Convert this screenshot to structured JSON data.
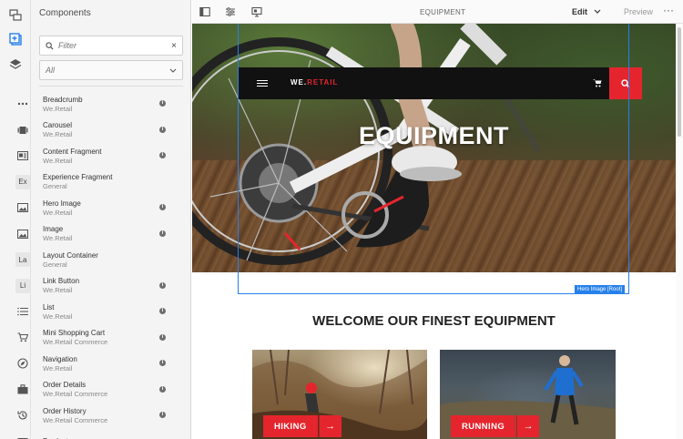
{
  "panel": {
    "title": "Components",
    "filter_placeholder": "Filter",
    "filter_clear": "×",
    "group_select": "All",
    "items": [
      {
        "name": "Breadcrumb",
        "group": "We.Retail",
        "icon": "more-horizontal-icon",
        "has_info": true
      },
      {
        "name": "Carousel",
        "group": "We.Retail",
        "icon": "carousel-icon",
        "has_info": true
      },
      {
        "name": "Content Fragment",
        "group": "We.Retail",
        "icon": "content-fragment-icon",
        "has_info": true
      },
      {
        "name": "Experience Fragment",
        "group": "General",
        "badge": "Ex",
        "has_info": false
      },
      {
        "name": "Hero Image",
        "group": "We.Retail",
        "icon": "image-icon",
        "has_info": true
      },
      {
        "name": "Image",
        "group": "We.Retail",
        "icon": "image-icon",
        "has_info": true
      },
      {
        "name": "Layout Container",
        "group": "General",
        "badge": "La",
        "has_info": false
      },
      {
        "name": "Link Button",
        "group": "We.Retail",
        "badge": "Li",
        "has_info": true
      },
      {
        "name": "List",
        "group": "We.Retail",
        "icon": "list-icon",
        "has_info": true
      },
      {
        "name": "Mini Shopping Cart",
        "group": "We.Retail Commerce",
        "icon": "cart-icon",
        "has_info": true
      },
      {
        "name": "Navigation",
        "group": "We.Retail",
        "icon": "compass-icon",
        "has_info": true
      },
      {
        "name": "Order Details",
        "group": "We.Retail Commerce",
        "icon": "briefcase-icon",
        "has_info": true
      },
      {
        "name": "Order History",
        "group": "We.Retail Commerce",
        "icon": "history-icon",
        "has_info": true
      },
      {
        "name": "Product",
        "group": "",
        "icon": "product-icon",
        "has_info": false
      }
    ]
  },
  "toolbar": {
    "page_title": "EQUIPMENT",
    "mode": "Edit",
    "preview": "Preview",
    "more": "···"
  },
  "site": {
    "logo_white": "WE.",
    "logo_red": "RETAIL",
    "hero_title": "EQUIPMENT",
    "selection_label": "Hero Image [Root]",
    "welcome": "WELCOME OUR FINEST EQUIPMENT",
    "cards": [
      {
        "label": "HIKING",
        "arrow": "→"
      },
      {
        "label": "RUNNING",
        "arrow": "→"
      }
    ]
  },
  "colors": {
    "accent_red": "#e5252d",
    "selection_blue": "#2680eb",
    "rail_active": "#2680eb"
  }
}
